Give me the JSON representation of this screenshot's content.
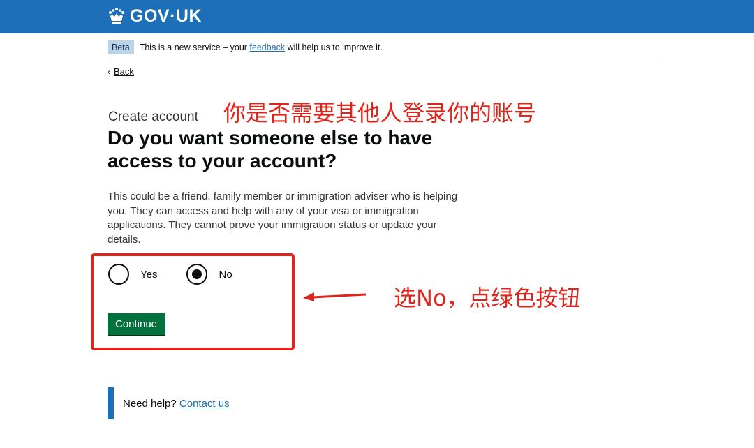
{
  "header": {
    "logo_text": "GOV·UK"
  },
  "phase_banner": {
    "tag": "Beta",
    "text_before": "This is a new service – your ",
    "link": "feedback",
    "text_after": " will help us to improve it."
  },
  "back_link": "Back",
  "caption": "Create account",
  "heading": "Do you want someone else to have access to your account?",
  "hint": "This could be a friend, family member or immigration adviser who is helping you. They can access and help with any of your visa or immigration applications. They cannot prove your immigration status or update your details.",
  "radios": [
    {
      "label": "Yes",
      "selected": false
    },
    {
      "label": "No",
      "selected": true
    }
  ],
  "continue_label": "Continue",
  "help": {
    "text": "Need help? ",
    "link": "Contact us"
  },
  "annotations": {
    "title": "你是否需要其他人登录你的账号",
    "instruction": "选No，点绿色按钮",
    "color": "#e2231a"
  },
  "colors": {
    "header_blue": "#1d70b8",
    "button_green": "#00703c",
    "phase_tag_bg": "#bbd4ea"
  }
}
